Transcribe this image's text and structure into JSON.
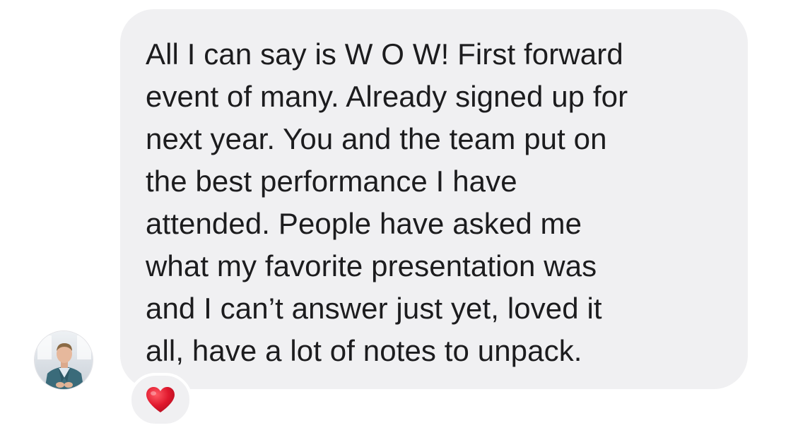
{
  "message": {
    "text": "All I can say is W O W!  First forward\nevent of many.  Already signed up for\nnext year.  You and the team put on\nthe best performance I have\nattended.  People have asked me\nwhat my favorite presentation was\nand I can’t answer just yet, loved it\nall, have a lot of notes to unpack.",
    "reaction_icon": "red-heart-icon"
  },
  "colors": {
    "bubble": "#f0f0f2",
    "text": "#1c1c1e",
    "heart": "#e0182d"
  }
}
